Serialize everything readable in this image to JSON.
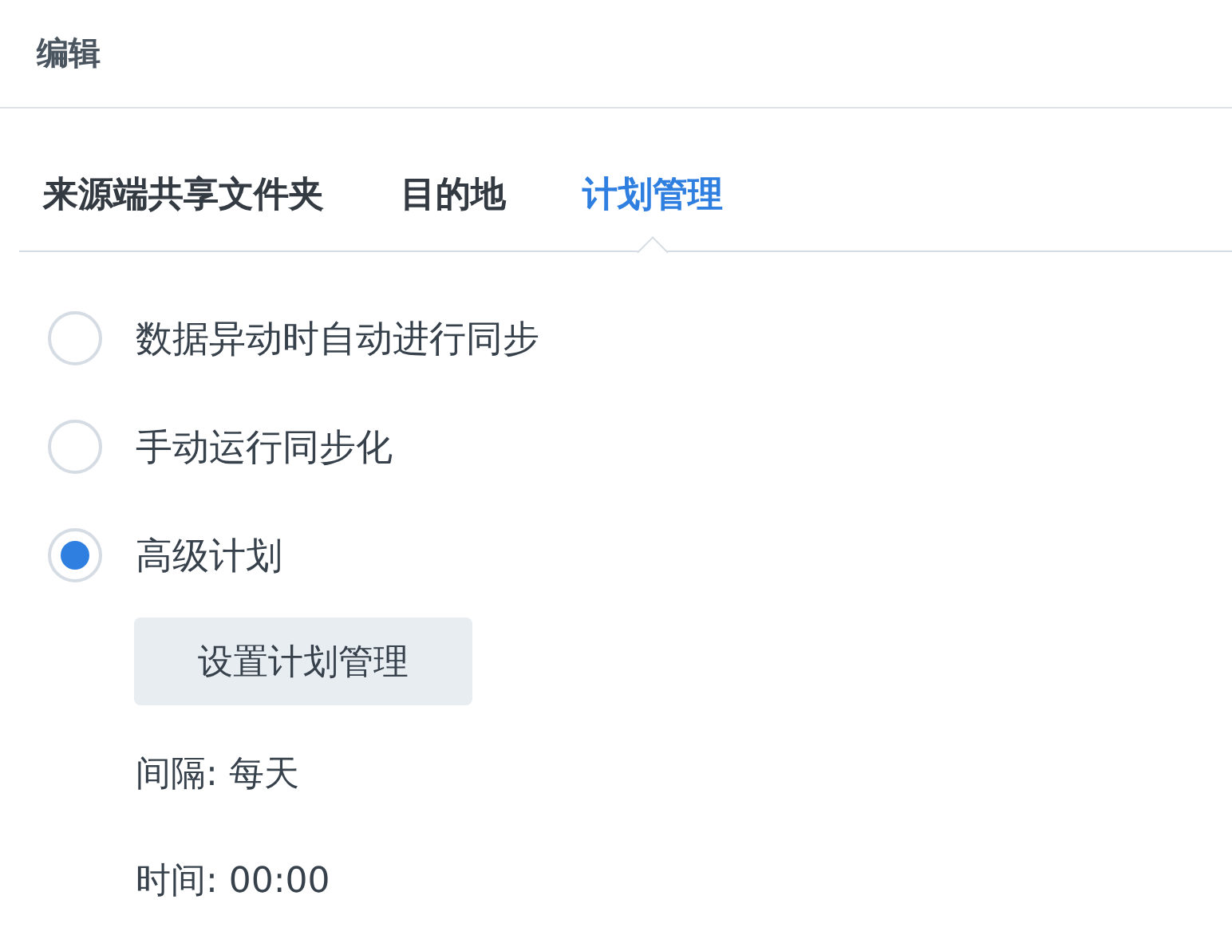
{
  "header": {
    "title": "编辑"
  },
  "tabs": [
    {
      "label": "来源端共享文件夹",
      "selected": false
    },
    {
      "label": "目的地",
      "selected": false
    },
    {
      "label": "计划管理",
      "selected": true
    }
  ],
  "schedule_options": [
    {
      "label": "数据异动时自动进行同步",
      "selected": false
    },
    {
      "label": "手动运行同步化",
      "selected": false
    },
    {
      "label": "高级计划",
      "selected": true
    }
  ],
  "settings_button": "设置计划管理",
  "details": [
    "间隔: 每天",
    "时间: 00:00"
  ]
}
